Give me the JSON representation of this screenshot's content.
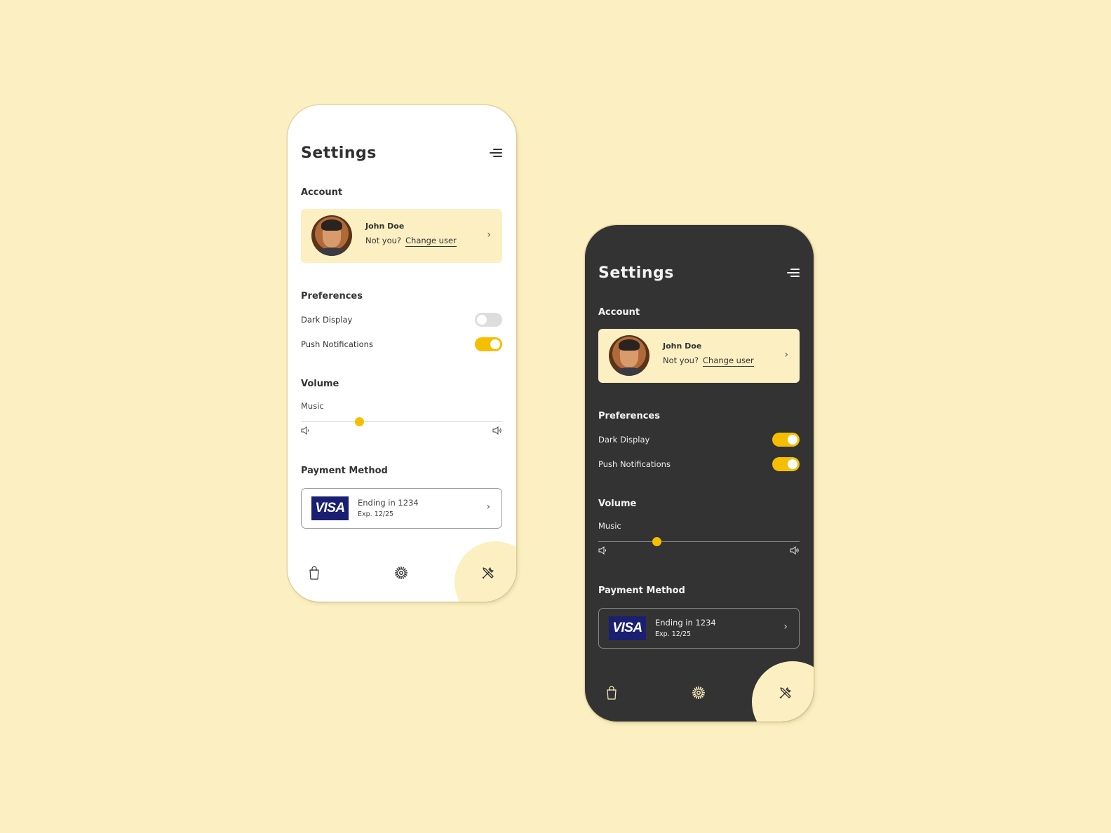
{
  "colors": {
    "background": "#fcf0c2",
    "accent": "#f5bf00",
    "light_surface": "#ffffff",
    "dark_surface": "#333333",
    "account_card": "#fcefc2",
    "visa_blue": "#1a1f71"
  },
  "screens": [
    {
      "theme": "light",
      "title": "Settings",
      "menu_icon": "menu-icon",
      "account": {
        "label": "Account",
        "name": "John Doe",
        "prompt": "Not you?",
        "change_link": "Change user",
        "chevron": "›"
      },
      "preferences": {
        "label": "Preferences",
        "items": [
          {
            "label": "Dark Display",
            "on": false
          },
          {
            "label": "Push Notifications",
            "on": true
          }
        ]
      },
      "volume": {
        "label": "Volume",
        "music_label": "Music",
        "music_level": 0.29
      },
      "payment": {
        "label": "Payment Method",
        "brand": "VISA",
        "ending": "Ending in 1234",
        "expiry": "Exp. 12/25",
        "chevron": "›"
      },
      "nav": {
        "items": [
          "bag-icon",
          "sun-icon",
          "tools-icon"
        ],
        "active": "tools-icon"
      }
    },
    {
      "theme": "dark",
      "title": "Settings",
      "menu_icon": "menu-icon",
      "account": {
        "label": "Account",
        "name": "John Doe",
        "prompt": "Not you?",
        "change_link": "Change user",
        "chevron": "›"
      },
      "preferences": {
        "label": "Preferences",
        "items": [
          {
            "label": "Dark Display",
            "on": true
          },
          {
            "label": "Push Notifications",
            "on": true
          }
        ]
      },
      "volume": {
        "label": "Volume",
        "music_label": "Music",
        "music_level": 0.29
      },
      "payment": {
        "label": "Payment Method",
        "brand": "VISA",
        "ending": "Ending in 1234",
        "expiry": "Exp. 12/25",
        "chevron": "›"
      },
      "nav": {
        "items": [
          "bag-icon",
          "sun-icon",
          "tools-icon"
        ],
        "active": "tools-icon"
      }
    }
  ]
}
